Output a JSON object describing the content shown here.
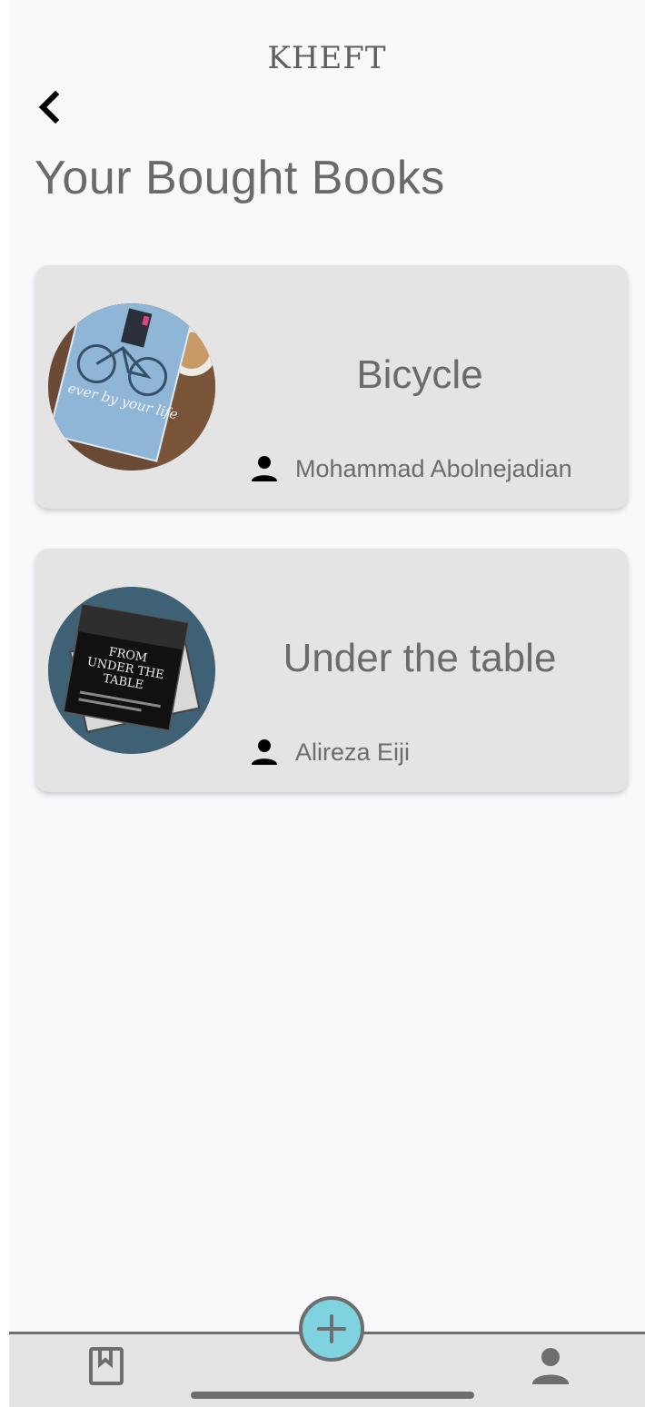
{
  "header": {
    "app_title": "KHEFT",
    "back_icon": "chevron-left-icon",
    "page_title": "Your Bought Books"
  },
  "books": [
    {
      "title": "Bicycle",
      "author": "Mohammad Abolnejadian",
      "author_icon": "person-icon"
    },
    {
      "title": "Under the table",
      "author": "Alireza Eiji",
      "author_icon": "person-icon"
    }
  ],
  "cover_text": {
    "book1": "ever by your life",
    "book2_line1": "FROM",
    "book2_line2": "UNDER THE",
    "book2_line3": "TABLE"
  },
  "bottom_nav": {
    "left_icon": "bookmark-book-icon",
    "fab_icon": "plus-icon",
    "right_icon": "person-icon"
  },
  "colors": {
    "background": "#f9f9fc",
    "card": "#e4e4e4",
    "fab": "#7fd3e0",
    "text_muted": "#6b6b6b"
  }
}
